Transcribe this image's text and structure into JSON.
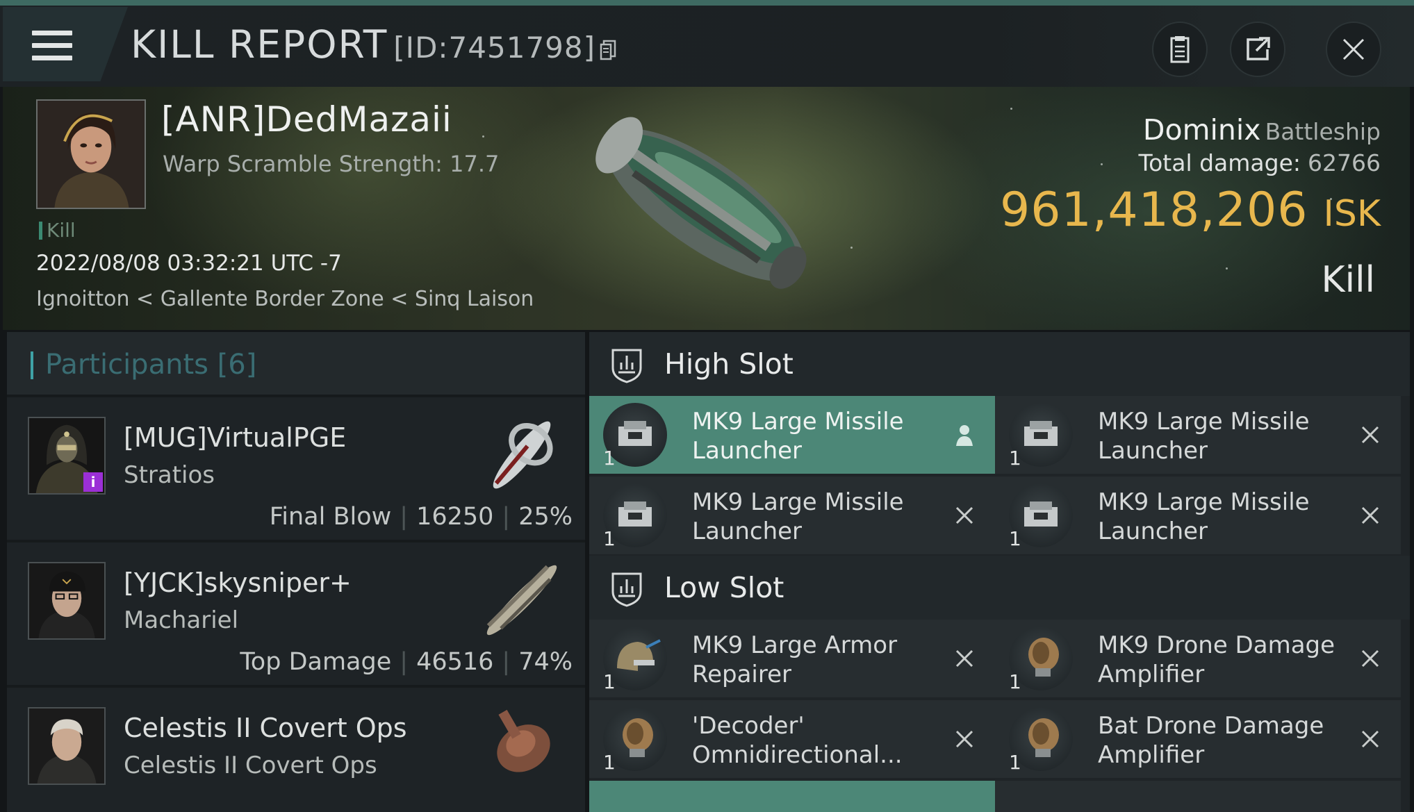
{
  "header": {
    "title": "KILL REPORT",
    "report_id": "[ID:7451798]",
    "menu_icon": "hamburger-menu-icon",
    "buttons": [
      {
        "name": "clipboard-button",
        "icon": "clipboard-icon"
      },
      {
        "name": "share-button",
        "icon": "share-icon"
      },
      {
        "name": "close-button",
        "icon": "close-icon"
      }
    ]
  },
  "victim": {
    "name": "[ANR]DedMazaii",
    "warp_scramble": "Warp Scramble Strength: 17.7",
    "tag": "Kill",
    "timestamp": "2022/08/08 03:32:21 UTC -7",
    "location": "Ignoitton < Gallente Border Zone < Sinq Laison",
    "ship_name": "Dominix",
    "ship_class": "Battleship",
    "total_damage_label": "Total damage:",
    "total_damage": "62766",
    "isk_value": "961,418,206",
    "isk_unit": "ISK",
    "result": "Kill"
  },
  "participants": {
    "title": "Participants [6]",
    "items": [
      {
        "name": "[MUG]VirtualPGE",
        "ship": "Stratios",
        "label": "Final Blow",
        "damage": "16250",
        "percent": "25%",
        "badge": "i"
      },
      {
        "name": "[YJCK]skysniper+",
        "ship": "Machariel",
        "label": "Top Damage",
        "damage": "46516",
        "percent": "74%"
      },
      {
        "name": "Celestis II Covert Ops",
        "ship": "Celestis II Covert Ops"
      }
    ]
  },
  "fitting": {
    "high_slot": {
      "title": "High Slot",
      "modules": [
        {
          "name": "MK9 Large Missile Launcher",
          "qty": "1",
          "state": "highlighted"
        },
        {
          "name": "MK9 Large Missile Launcher",
          "qty": "1",
          "state": "destroyed"
        },
        {
          "name": "MK9 Large Missile Launcher",
          "qty": "1",
          "state": "destroyed"
        },
        {
          "name": "MK9 Large Missile Launcher",
          "qty": "1",
          "state": "destroyed"
        }
      ]
    },
    "low_slot": {
      "title": "Low Slot",
      "modules": [
        {
          "name": "MK9 Large Armor Repairer",
          "qty": "1",
          "state": "destroyed"
        },
        {
          "name": "MK9 Drone Damage Amplifier",
          "qty": "1",
          "state": "destroyed"
        },
        {
          "name": "'Decoder' Omnidirectional...",
          "qty": "1",
          "state": "destroyed"
        },
        {
          "name": "Bat Drone Damage Amplifier",
          "qty": "1",
          "state": "destroyed"
        }
      ]
    }
  },
  "colors": {
    "accent": "#4c8777",
    "isk": "#e8b74d",
    "participants_title": "#3a6d73"
  }
}
